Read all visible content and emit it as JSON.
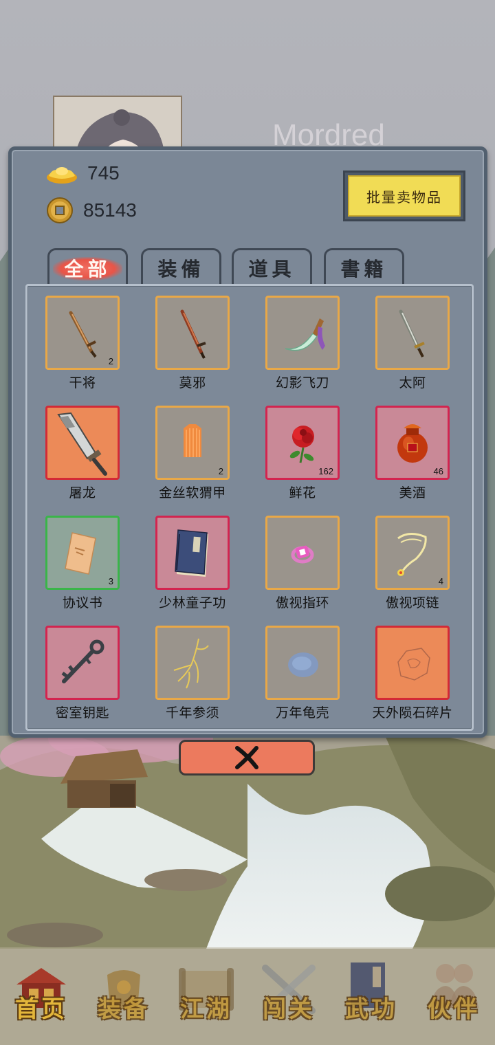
{
  "player": {
    "name": "Mordred"
  },
  "currency": {
    "gold_ingot": {
      "icon": "gold-ingot-icon",
      "value": "745"
    },
    "coin": {
      "icon": "copper-coin-icon",
      "value": "85143"
    }
  },
  "actions": {
    "sell_bulk_label": "批量卖物品"
  },
  "tabs": [
    {
      "label": "全部",
      "active": true
    },
    {
      "label": "装備",
      "active": false
    },
    {
      "label": "道具",
      "active": false
    },
    {
      "label": "書籍",
      "active": false
    }
  ],
  "items": [
    {
      "name": "干将",
      "count": "2",
      "quality": "orange",
      "icon": "sword-icon"
    },
    {
      "name": "莫邪",
      "count": "",
      "quality": "orange",
      "icon": "sword-icon"
    },
    {
      "name": "幻影飞刀",
      "count": "",
      "quality": "orange",
      "icon": "flying-knife-icon"
    },
    {
      "name": "太阿",
      "count": "",
      "quality": "orange",
      "icon": "sword-icon"
    },
    {
      "name": "屠龙",
      "count": "",
      "quality": "red-strong",
      "icon": "broadsword-icon"
    },
    {
      "name": "金丝软猬甲",
      "count": "2",
      "quality": "orange",
      "icon": "armor-vest-icon"
    },
    {
      "name": "鲜花",
      "count": "162",
      "quality": "red",
      "icon": "rose-icon"
    },
    {
      "name": "美酒",
      "count": "46",
      "quality": "red",
      "icon": "wine-jar-icon"
    },
    {
      "name": "协议书",
      "count": "3",
      "quality": "green",
      "icon": "document-icon"
    },
    {
      "name": "少林童子功",
      "count": "",
      "quality": "red",
      "icon": "book-icon"
    },
    {
      "name": "傲视指环",
      "count": "",
      "quality": "orange",
      "icon": "ring-icon"
    },
    {
      "name": "傲视项链",
      "count": "4",
      "quality": "orange",
      "icon": "necklace-icon"
    },
    {
      "name": "密室钥匙",
      "count": "",
      "quality": "red",
      "icon": "key-icon"
    },
    {
      "name": "千年参须",
      "count": "",
      "quality": "orange",
      "icon": "ginseng-root-icon"
    },
    {
      "name": "万年龟壳",
      "count": "",
      "quality": "orange",
      "icon": "turtle-shell-icon"
    },
    {
      "name": "天外陨石碎片",
      "count": "",
      "quality": "red-strong",
      "icon": "meteorite-icon"
    }
  ],
  "close_icon": "close-x-icon",
  "nav": [
    {
      "label": "首页",
      "icon": "house-icon"
    },
    {
      "label": "装备",
      "icon": "armor-icon"
    },
    {
      "label": "江湖",
      "icon": "scroll-map-icon"
    },
    {
      "label": "闯关",
      "icon": "crossed-swords-icon"
    },
    {
      "label": "武功",
      "icon": "manual-book-icon"
    },
    {
      "label": "伙伴",
      "icon": "partners-icon"
    }
  ]
}
